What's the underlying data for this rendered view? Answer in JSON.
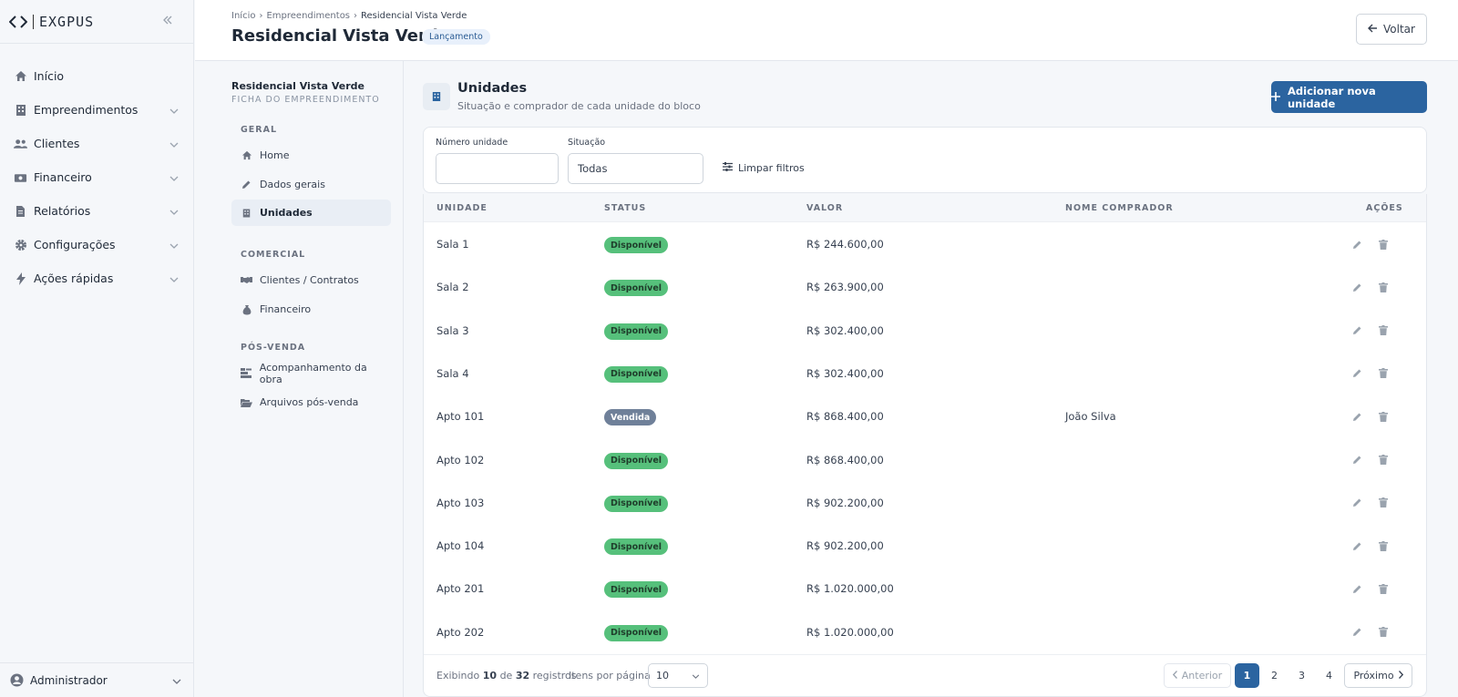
{
  "brand": {
    "logo_text": "EXGPUS"
  },
  "sidebar": {
    "items": [
      {
        "label": "Início",
        "icon": "home-icon"
      },
      {
        "label": "Empreendimentos",
        "icon": "building-icon"
      },
      {
        "label": "Clientes",
        "icon": "users-icon"
      },
      {
        "label": "Financeiro",
        "icon": "money-icon"
      },
      {
        "label": "Relatórios",
        "icon": "report-icon"
      },
      {
        "label": "Configurações",
        "icon": "gear-icon"
      },
      {
        "label": "Ações rápidas",
        "icon": "bolt-icon"
      }
    ],
    "user": "Administrador"
  },
  "header": {
    "breadcrumb": [
      "Início",
      "Empreendimentos",
      "Residencial Vista Verde"
    ],
    "title": "Residencial Vista Verde",
    "badge": "Lançamento",
    "back_label": "Voltar"
  },
  "subnav": {
    "title": "Residencial Vista Verde",
    "subtitle": "FICHA DO EMPREENDIMENTO",
    "sections": [
      {
        "label": "GERAL",
        "items": [
          "Home",
          "Dados gerais",
          "Unidades"
        ]
      },
      {
        "label": "COMERCIAL",
        "items": [
          "Clientes / Contratos",
          "Financeiro"
        ]
      },
      {
        "label": "PÓS-VENDA",
        "items": [
          "Acompanhamento da obra",
          "Arquivos pós-venda"
        ]
      }
    ],
    "active": "Unidades"
  },
  "main": {
    "title": "Unidades",
    "subtitle": "Situação e comprador de cada unidade do bloco",
    "add_label": "Adicionar nova unidade"
  },
  "filters": {
    "numero_label": "Número unidade",
    "numero_value": "",
    "situacao_label": "Situação",
    "situacao_value": "Todas",
    "clear_label": "Limpar filtros"
  },
  "table": {
    "columns": [
      "UNIDADE",
      "STATUS",
      "VALOR",
      "NOME COMPRADOR",
      "AÇÕES"
    ],
    "rows": [
      {
        "unidade": "Sala 1",
        "status": "Disponível",
        "valor": "R$ 244.600,00",
        "comprador": ""
      },
      {
        "unidade": "Sala 2",
        "status": "Disponível",
        "valor": "R$ 263.900,00",
        "comprador": ""
      },
      {
        "unidade": "Sala 3",
        "status": "Disponível",
        "valor": "R$ 302.400,00",
        "comprador": ""
      },
      {
        "unidade": "Sala 4",
        "status": "Disponível",
        "valor": "R$ 302.400,00",
        "comprador": ""
      },
      {
        "unidade": "Apto 101",
        "status": "Vendida",
        "valor": "R$ 868.400,00",
        "comprador": "João Silva"
      },
      {
        "unidade": "Apto 102",
        "status": "Disponível",
        "valor": "R$ 868.400,00",
        "comprador": ""
      },
      {
        "unidade": "Apto 103",
        "status": "Disponível",
        "valor": "R$ 902.200,00",
        "comprador": ""
      },
      {
        "unidade": "Apto 104",
        "status": "Disponível",
        "valor": "R$ 902.200,00",
        "comprador": ""
      },
      {
        "unidade": "Apto 201",
        "status": "Disponível",
        "valor": "R$ 1.020.000,00",
        "comprador": ""
      },
      {
        "unidade": "Apto 202",
        "status": "Disponível",
        "valor": "R$ 1.020.000,00",
        "comprador": ""
      }
    ]
  },
  "pagination": {
    "prefix": "Exibindo",
    "shown": "10",
    "mid": "de",
    "total": "32",
    "suffix": "registros",
    "per_page_label": "Itens por página",
    "per_page_value": "10",
    "prev_label": "Anterior",
    "next_label": "Próximo",
    "pages": [
      "1",
      "2",
      "3",
      "4"
    ],
    "current": "1"
  },
  "colors": {
    "primary": "#2b64a0",
    "available": "#56c07b",
    "sold": "#6f8099"
  }
}
